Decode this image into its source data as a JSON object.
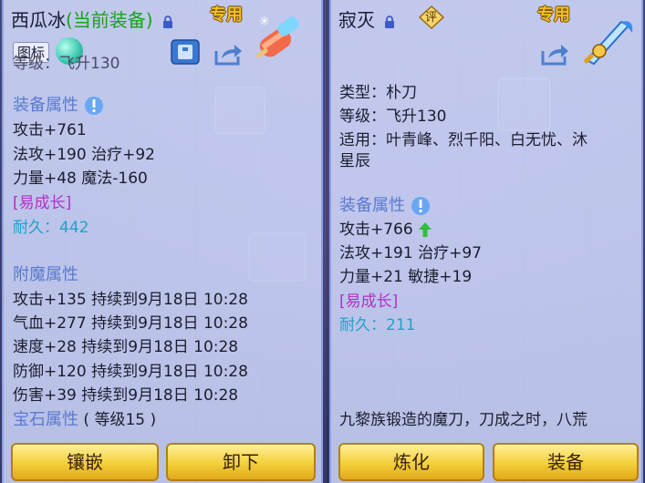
{
  "left": {
    "name": "西瓜冰",
    "status": "(当前装备)",
    "exclusive": "专用",
    "tag_label": "图标",
    "level_partial": "等级：飞升130",
    "attr_header": "装备属性",
    "attrs": [
      "攻击+761",
      "法攻+190 治疗+92",
      "力量+48 魔法-160"
    ],
    "growth": "[易成长]",
    "durability": "耐久：442",
    "enchant_header": "附魔属性",
    "enchants": [
      "攻击+135 持续到9月18日 10:28",
      "气血+277 持续到9月18日 10:28",
      "速度+28 持续到9月18日 10:28",
      "防御+120 持续到9月18日 10:28",
      "伤害+39 持续到9月18日 10:28"
    ],
    "gem_header": "宝石属性",
    "gem_level": "( 等级15 )",
    "buttons": [
      "镶嵌",
      "卸下"
    ]
  },
  "right": {
    "name": "寂灭",
    "review": "评",
    "exclusive": "专用",
    "type": "类型：朴刀",
    "level": "等级：飞升130",
    "suitable_1": "适用：叶青峰、烈千阳、白无忧、沐",
    "suitable_2": "星辰",
    "attr_header": "装备属性",
    "attrs": [
      "攻击+766",
      "法攻+191 治疗+97",
      "力量+21 敏捷+19"
    ],
    "growth": "[易成长]",
    "durability": "耐久：211",
    "desc_1": "九黎族锻造的魔刀，刀成之时，八荒",
    "buttons": [
      "炼化",
      "装备"
    ]
  },
  "colors": {
    "section": "#5a7ad0",
    "growth": "#b030c8",
    "durability": "#1ea3c8",
    "equipped": "#17a21c",
    "button": "#f3cf3a"
  }
}
